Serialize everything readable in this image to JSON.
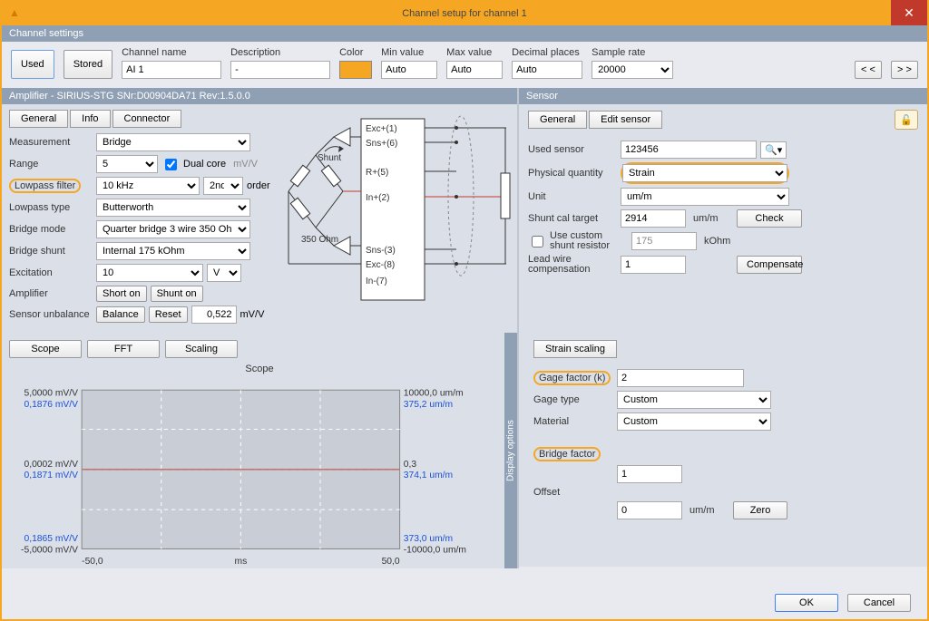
{
  "window": {
    "title": "Channel setup for channel 1"
  },
  "header": {
    "section": "Channel settings",
    "used": "Used",
    "stored": "Stored",
    "channel_name_lbl": "Channel name",
    "channel_name": "AI 1",
    "description_lbl": "Description",
    "description": "-",
    "color_lbl": "Color",
    "min_lbl": "Min value",
    "min": "Auto",
    "max_lbl": "Max value",
    "max": "Auto",
    "decimal_lbl": "Decimal places",
    "decimal": "Auto",
    "sample_lbl": "Sample rate",
    "sample": "20000",
    "prev": "< <",
    "next": "> >"
  },
  "amplifier": {
    "title": "Amplifier - SIRIUS-STG  SNr:D00904DA71 Rev:1.5.0.0",
    "tabs": {
      "general": "General",
      "info": "Info",
      "connector": "Connector"
    },
    "measurement_lbl": "Measurement",
    "measurement": "Bridge",
    "range_lbl": "Range",
    "range": "5",
    "dualcore_lbl": "Dual core",
    "mvv": "mV/V",
    "lowpass_filter_lbl": "Lowpass filter",
    "lowpass_filter": "10 kHz",
    "lowpass_order": "2nd",
    "order": "order",
    "lowpass_type_lbl": "Lowpass type",
    "lowpass_type": "Butterworth",
    "bridge_mode_lbl": "Bridge mode",
    "bridge_mode": "Quarter bridge 3 wire 350 Ohm",
    "bridge_shunt_lbl": "Bridge shunt",
    "bridge_shunt": "Internal 175 kOhm",
    "excitation_lbl": "Excitation",
    "excitation": "10",
    "excitation_unit": "V",
    "amplifier_lbl": "Amplifier",
    "short_on": "Short on",
    "shunt_on": "Shunt on",
    "unbalance_lbl": "Sensor unbalance",
    "balance": "Balance",
    "reset": "Reset",
    "unbalance_val": "0,522",
    "diagram": {
      "exc_p": "Exc+(1)",
      "sns_p": "Sns+(6)",
      "r_p": "R+(5)",
      "in_p": "In+(2)",
      "sns_n": "Sns-(3)",
      "exc_n": "Exc-(8)",
      "in_n": "In-(7)",
      "shunt": "Shunt",
      "ohm350": "350 Ohm",
      "ohm350v": "350 ohm"
    }
  },
  "sensor": {
    "title": "Sensor",
    "tabs": {
      "general": "General",
      "edit": "Edit sensor"
    },
    "used_lbl": "Used sensor",
    "used": "123456",
    "phys_lbl": "Physical quantity",
    "phys": "Strain",
    "unit_lbl": "Unit",
    "unit": "um/m",
    "shunt_target_lbl": "Shunt cal target",
    "shunt_target": "2914",
    "shunt_target_unit": "um/m",
    "check": "Check",
    "use_custom_lbl": "Use custom shunt resistor",
    "custom_val": "175",
    "custom_unit": "kOhm",
    "leadwire_lbl": "Lead wire compensation",
    "leadwire_val": "1",
    "compensate": "Compensate"
  },
  "scope": {
    "tabs": {
      "scope": "Scope",
      "fft": "FFT",
      "scaling": "Scaling"
    },
    "title": "Scope",
    "display_options": "Display options",
    "x_unit": "ms",
    "x_min": "-50,0",
    "x_max": "50,0",
    "yl_top": "5,0000 mV/V",
    "yl_top2": "0,1876 mV/V",
    "yl_mid": "0,0002 mV/V",
    "yl_mid2": "0,1871 mV/V",
    "yl_bot": "0,1865 mV/V",
    "yl_bot2": "-5,0000 mV/V",
    "yr_top": "10000,0 um/m",
    "yr_top2": "375,2 um/m",
    "yr_mid": "0,3",
    "yr_mid2": "374,1 um/m",
    "yr_bot": "373,0 um/m",
    "yr_bot2": "-10000,0 um/m"
  },
  "scaling": {
    "title": "Strain scaling",
    "gage_factor_lbl": "Gage factor (k)",
    "gage_factor": "2",
    "gage_type_lbl": "Gage type",
    "gage_type": "Custom",
    "material_lbl": "Material",
    "material": "Custom",
    "bridge_factor_lbl": "Bridge factor",
    "bridge_factor": "1",
    "offset_lbl": "Offset",
    "offset": "0",
    "offset_unit": "um/m",
    "zero": "Zero"
  },
  "footer": {
    "ok": "OK",
    "cancel": "Cancel"
  },
  "chart_data": {
    "type": "line",
    "title": "Scope",
    "xlabel": "ms",
    "xlim": [
      -50.0,
      50.0
    ],
    "series": [
      {
        "name": "mV/V (left axis)",
        "ylim": [
          -5.0,
          5.0
        ],
        "value_range_observed": [
          0.1865,
          0.1876
        ],
        "mean": 0.1871
      },
      {
        "name": "um/m (right axis)",
        "ylim": [
          -10000.0,
          10000.0
        ],
        "value_range_observed": [
          373.0,
          375.2
        ],
        "mean": 374.1
      }
    ],
    "overlay_center_values": {
      "left": 0.0002,
      "right": 0.3
    }
  }
}
